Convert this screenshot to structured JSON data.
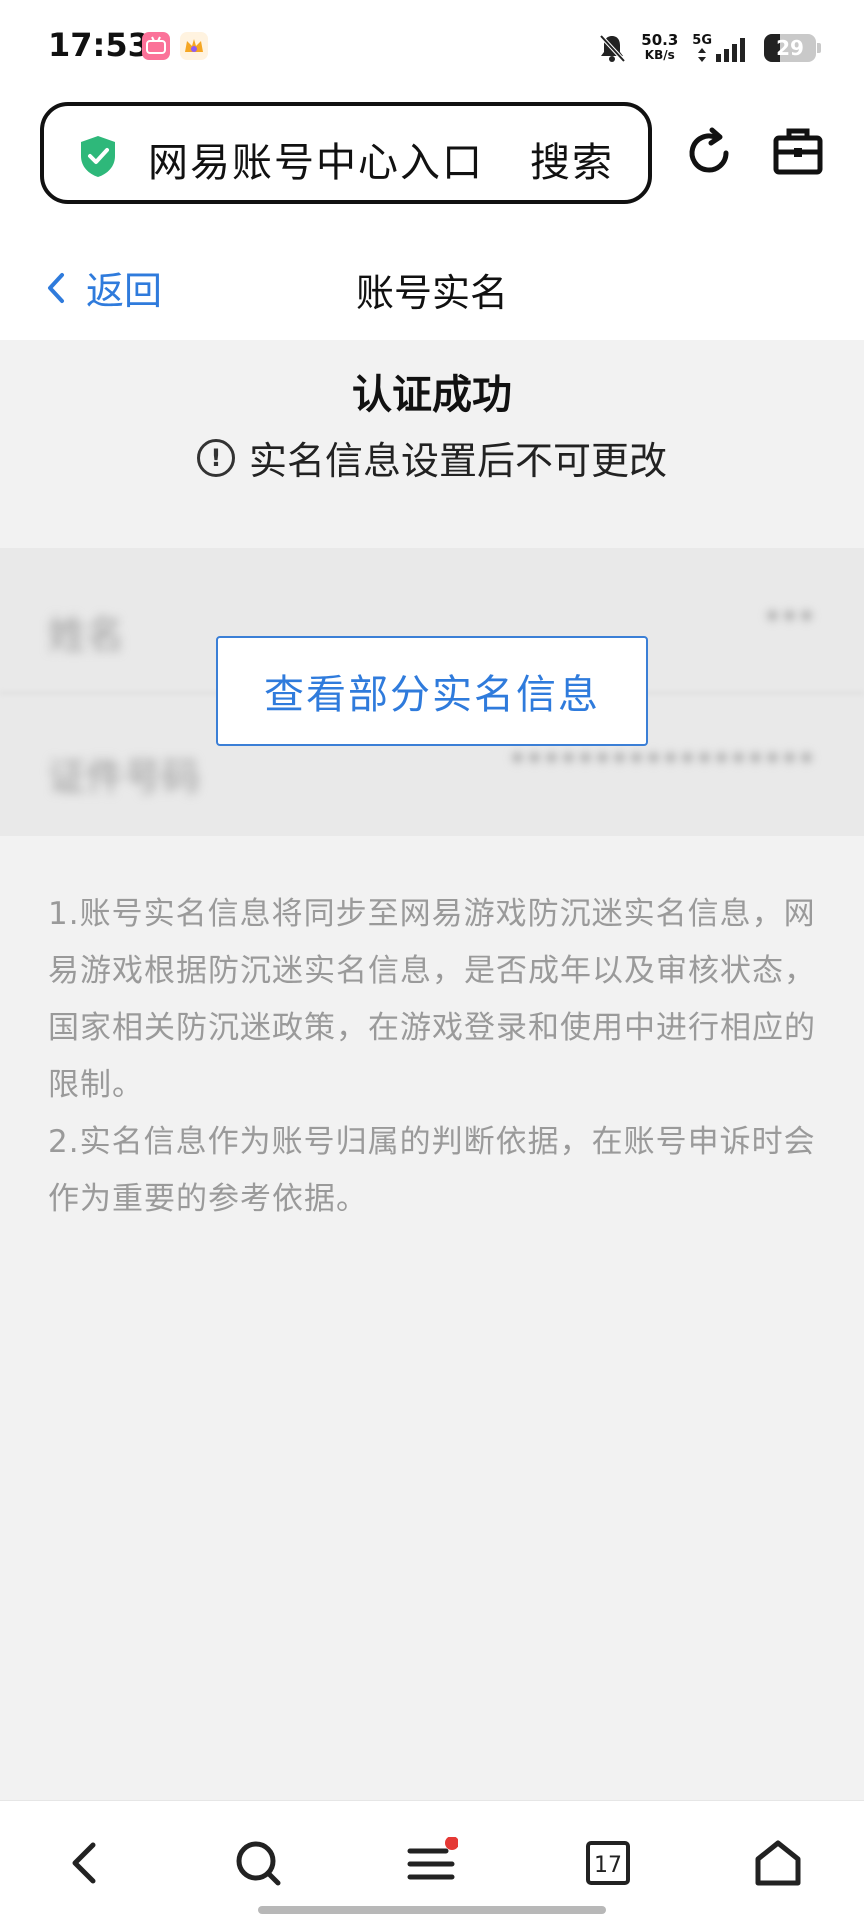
{
  "status_bar": {
    "time": "17:53",
    "net_speed_value": "50.3",
    "net_speed_unit": "KB/s",
    "network_type": "5G",
    "battery_level": "29"
  },
  "browser": {
    "address_text": "网易账号中心入口",
    "search_label": "搜索"
  },
  "header": {
    "back_label": "返回",
    "title": "账号实名"
  },
  "result": {
    "title": "认证成功",
    "notice": "实名信息设置后不可更改"
  },
  "info_card": {
    "name_label": "姓名",
    "name_value": "***",
    "id_label": "证件号码",
    "id_value": "******************",
    "view_button_label": "查看部分实名信息"
  },
  "notes": [
    "1.账号实名信息将同步至网易游戏防沉迷实名信息，网易游戏根据防沉迷实名信息，是否成年以及审核状态，国家相关防沉迷政策，在游戏登录和使用中进行相应的限制。",
    "2.实名信息作为账号归属的判断依据，在账号申诉时会作为重要的参考依据。"
  ],
  "bottom_nav": {
    "tabs_count": "17"
  },
  "colors": {
    "accent": "#2f7bdc",
    "shield": "#2eb87a",
    "badge_red": "#e53935"
  }
}
